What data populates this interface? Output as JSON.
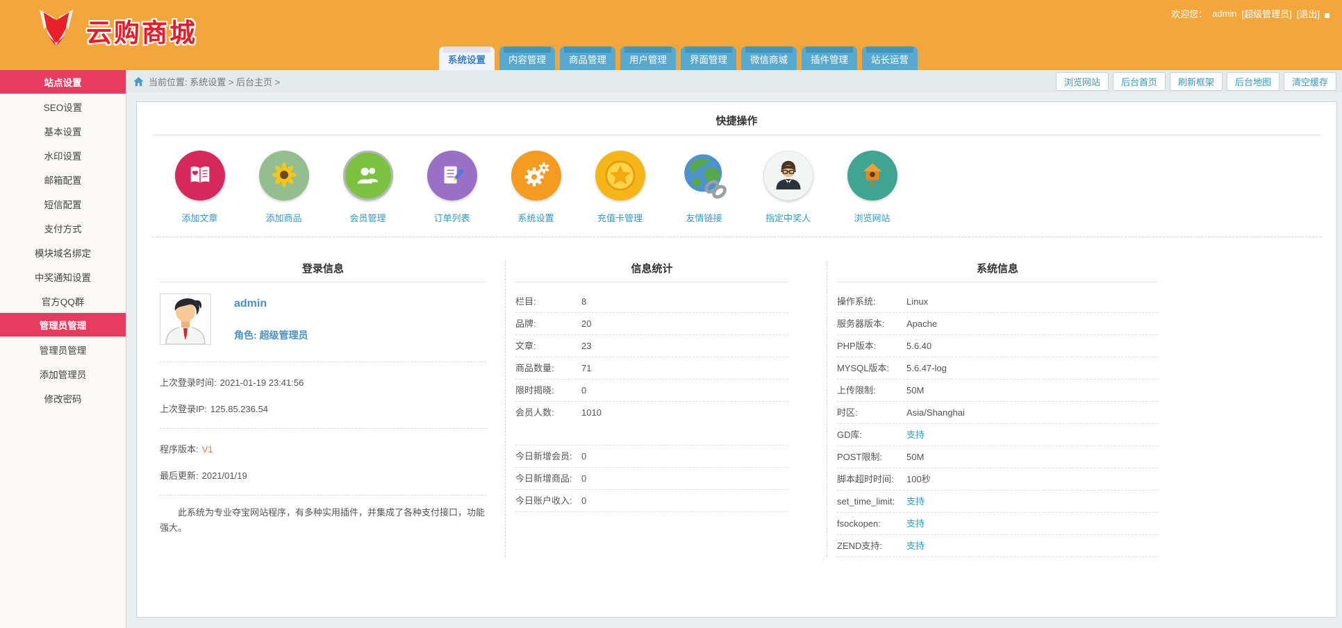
{
  "header": {
    "logo_text": "云购商城",
    "welcome_prefix": "欢迎您：",
    "username": "admin",
    "role_bracket": "[超级管理员]",
    "logout": "[退出]",
    "tabs": [
      {
        "label": "系统设置"
      },
      {
        "label": "内容管理"
      },
      {
        "label": "商品管理"
      },
      {
        "label": "用户管理"
      },
      {
        "label": "界面管理"
      },
      {
        "label": "微信商城"
      },
      {
        "label": "插件管理"
      },
      {
        "label": "站长运营"
      }
    ]
  },
  "breadcrumb": {
    "location": "当前位置: 系统设置 > 后台主页 >"
  },
  "toolbar": {
    "buttons": [
      {
        "label": "浏览网站"
      },
      {
        "label": "后台首页"
      },
      {
        "label": "刷新框架"
      },
      {
        "label": "后台地图"
      },
      {
        "label": "清空缓存"
      }
    ]
  },
  "sidebar": {
    "items": [
      {
        "label": "站点设置",
        "header": true
      },
      {
        "label": "SEO设置"
      },
      {
        "label": "基本设置"
      },
      {
        "label": "水印设置"
      },
      {
        "label": "邮箱配置"
      },
      {
        "label": "短信配置"
      },
      {
        "label": "支付方式"
      },
      {
        "label": "模块域名绑定"
      },
      {
        "label": "中奖通知设置"
      },
      {
        "label": "官方QQ群"
      },
      {
        "label": "管理员管理",
        "header": true
      },
      {
        "label": "管理员管理"
      },
      {
        "label": "添加管理员"
      },
      {
        "label": "修改密码"
      }
    ]
  },
  "quick": {
    "title": "快捷操作",
    "items": [
      {
        "label": "添加文章",
        "icon": "article-book-icon",
        "color": "#D5295E"
      },
      {
        "label": "添加商品",
        "icon": "sunflower-icon",
        "color": "#95BE90"
      },
      {
        "label": "会员管理",
        "icon": "members-icon",
        "color": "#7CC13F"
      },
      {
        "label": "订单列表",
        "icon": "order-list-icon",
        "color": "#9A6FC6"
      },
      {
        "label": "系统设置",
        "icon": "gears-icon",
        "color": "#F59B22"
      },
      {
        "label": "充值卡管理",
        "icon": "gold-coin-icon",
        "color": "#F6B519"
      },
      {
        "label": "友情链接",
        "icon": "globe-link-icon",
        "color": "#4D92CE"
      },
      {
        "label": "指定中奖人",
        "icon": "winner-person-icon",
        "color": "#F3F5F5"
      },
      {
        "label": "浏览网站",
        "icon": "birdhouse-icon",
        "color": "#3FA491"
      }
    ]
  },
  "login_panel": {
    "title": "登录信息",
    "username": "admin",
    "role_label": "角色:",
    "role_value": "超级管理员",
    "last_login_time_label": "上次登录时间:",
    "last_login_time": "2021-01-19 23:41:56",
    "last_login_ip_label": "上次登录IP:",
    "last_login_ip": "125.85.236.54",
    "version_label": "程序版本:",
    "version": "V1",
    "updated_label": "最后更新:",
    "updated": "2021/01/19",
    "description": "此系统为专业夺宝网站程序，有多种实用插件，并集成了各种支付接口，功能强大。"
  },
  "stats_panel": {
    "title": "信息统计",
    "rows1": [
      {
        "label": "栏目:",
        "value": "8"
      },
      {
        "label": "品牌:",
        "value": "20"
      },
      {
        "label": "文章:",
        "value": "23"
      },
      {
        "label": "商品数量:",
        "value": "71"
      },
      {
        "label": "限时揭晓:",
        "value": "0"
      },
      {
        "label": "会员人数:",
        "value": "1010"
      }
    ],
    "rows2": [
      {
        "label": "今日新增会员:",
        "value": "0"
      },
      {
        "label": "今日新增商品:",
        "value": "0"
      },
      {
        "label": "今日账户收入:",
        "value": "0"
      }
    ]
  },
  "system_panel": {
    "title": "系统信息",
    "rows": [
      {
        "label": "操作系统:",
        "value": "Linux"
      },
      {
        "label": "服务器版本:",
        "value": "Apache"
      },
      {
        "label": "PHP版本:",
        "value": "5.6.40"
      },
      {
        "label": "MYSQL版本:",
        "value": "5.6.47-log"
      },
      {
        "label": "上传限制:",
        "value": "50M"
      },
      {
        "label": "时区:",
        "value": "Asia/Shanghai"
      },
      {
        "label": "GD库:",
        "value": "支持",
        "link": true
      },
      {
        "label": "POST限制:",
        "value": "50M"
      },
      {
        "label": "脚本超时时间:",
        "value": "100秒"
      },
      {
        "label": "set_time_limit:",
        "value": "支持",
        "link": true
      },
      {
        "label": "fsockopen:",
        "value": "支持",
        "link": true
      },
      {
        "label": "ZEND支持:",
        "value": "支持",
        "link": true
      }
    ]
  },
  "colors": {
    "header_orange": "#F3A63C",
    "tab_blue": "#58A9D0",
    "tab_strip_blue": "#3E96C2",
    "sidebar_pink": "#E73B60",
    "link_blue": "#2E9BCE",
    "version_orange": "#F4703A",
    "logo_red": "#E31E2B"
  }
}
